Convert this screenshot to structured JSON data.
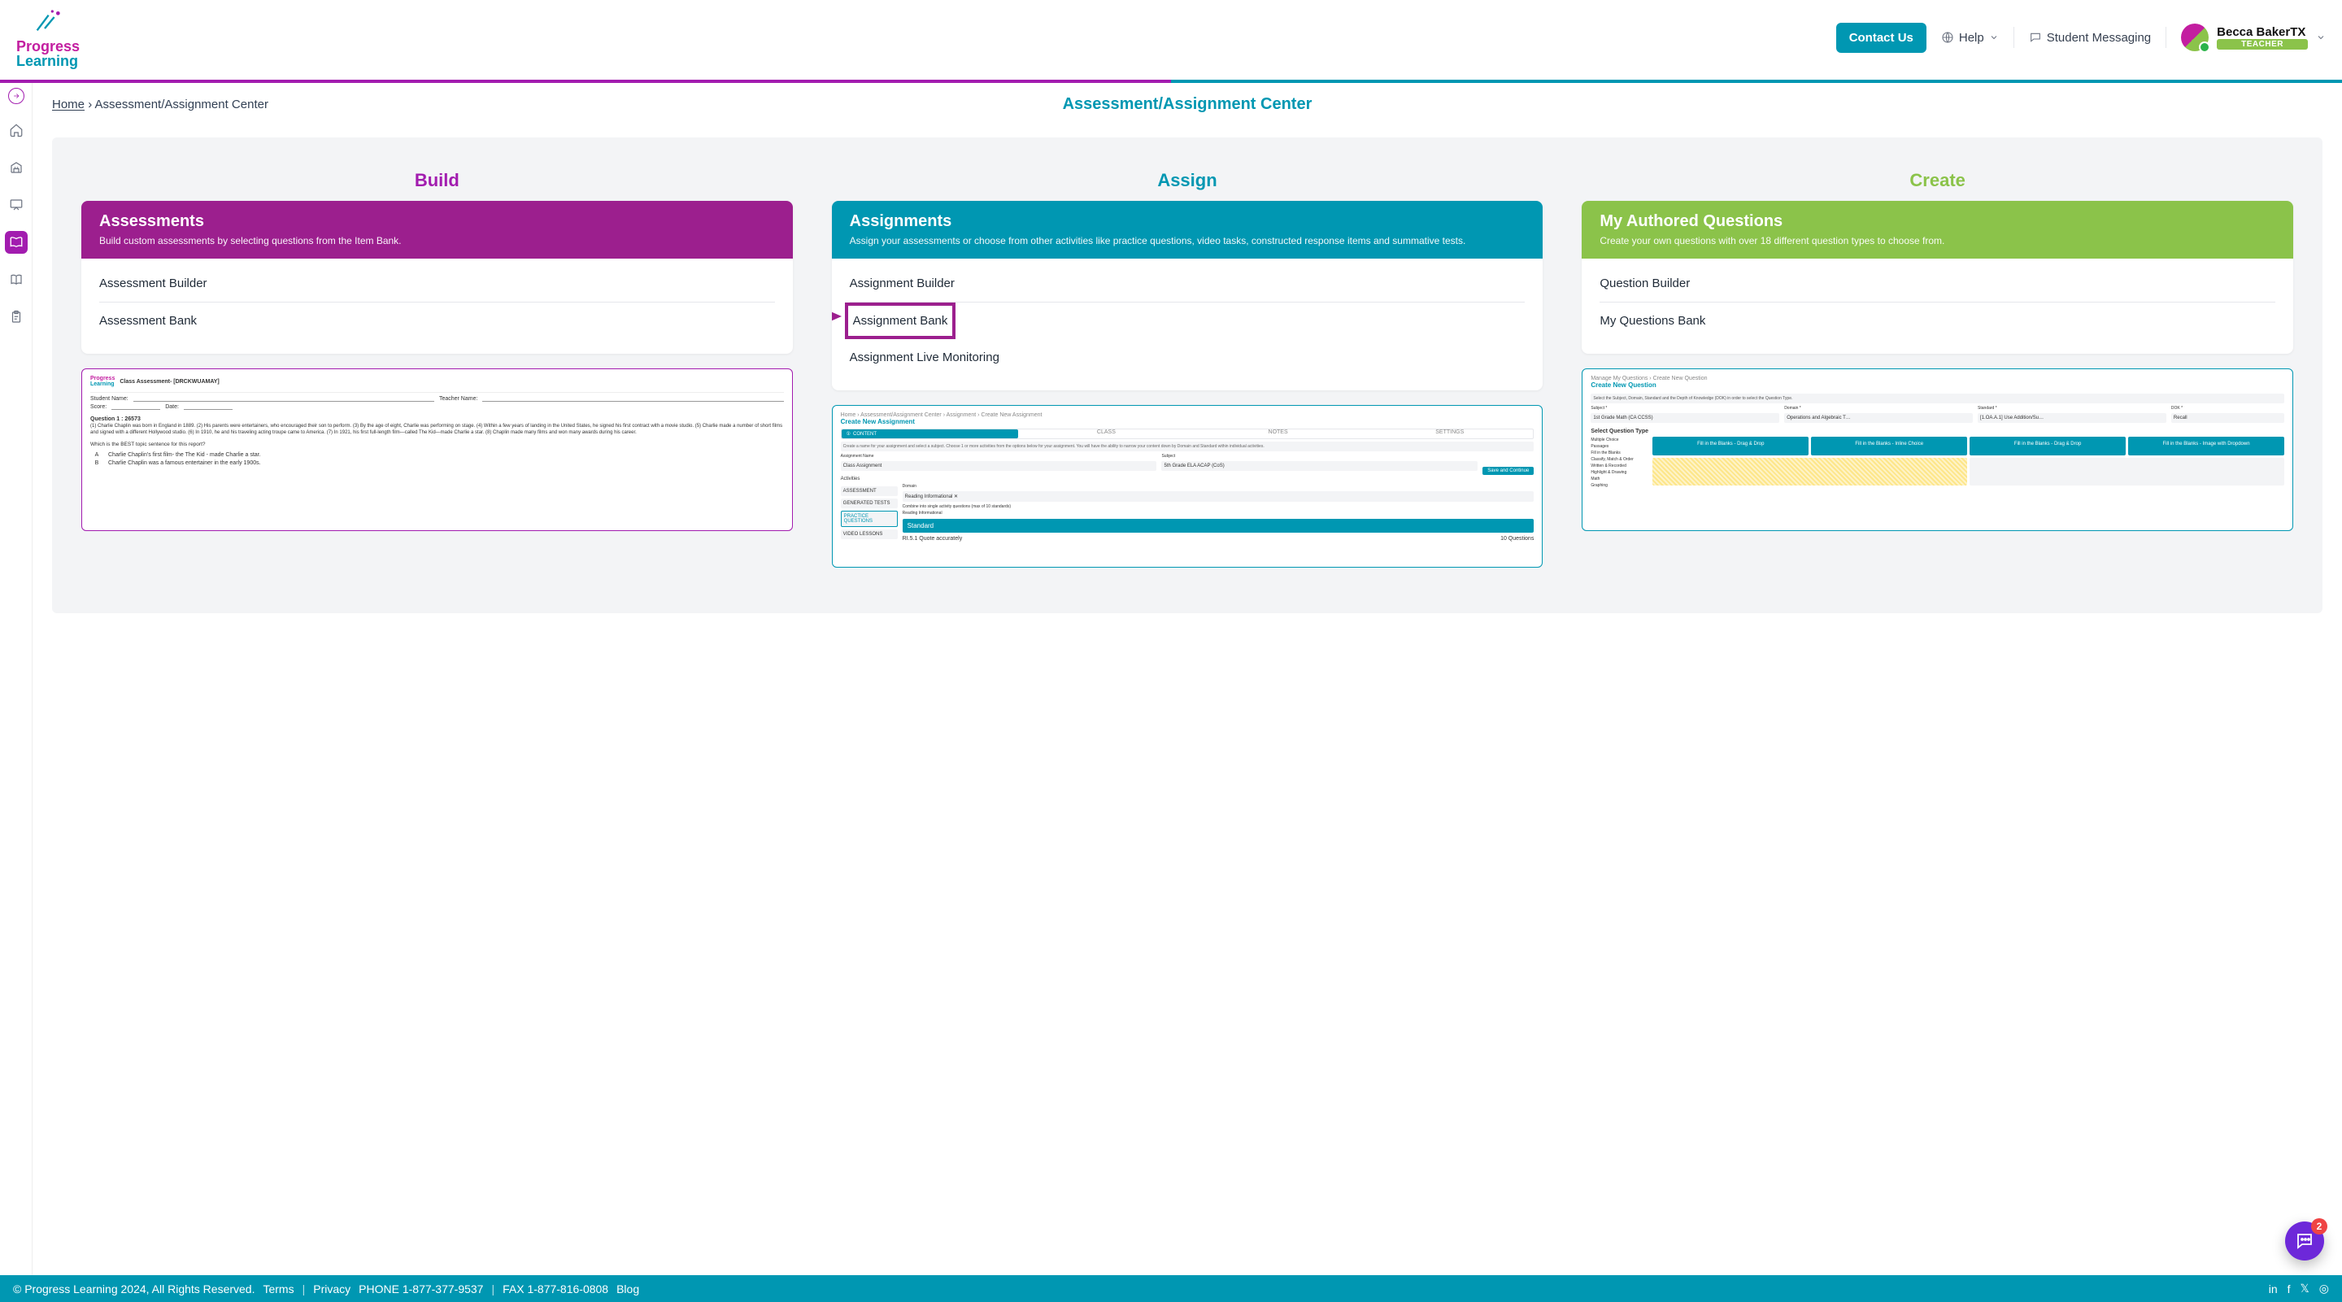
{
  "header": {
    "brand_top": "Progress",
    "brand_bottom": "Learning",
    "contact_us": "Contact Us",
    "help": "Help",
    "student_messaging": "Student Messaging",
    "user_name": "Becca BakerTX",
    "user_role": "TEACHER"
  },
  "breadcrumb": {
    "home": "Home",
    "current": "Assessment/Assignment Center"
  },
  "page_title": "Assessment/Assignment Center",
  "columns": {
    "build": {
      "heading": "Build",
      "card_title": "Assessments",
      "card_sub": "Build custom assessments by selecting questions from the Item Bank.",
      "links": [
        "Assessment Builder",
        "Assessment Bank"
      ]
    },
    "assign": {
      "heading": "Assign",
      "card_title": "Assignments",
      "card_sub": "Assign your assessments or choose from other activities like practice questions, video tasks, constructed response items and summative tests.",
      "links": [
        "Assignment Builder",
        "Assignment Bank",
        "Assignment Live Monitoring"
      ]
    },
    "create": {
      "heading": "Create",
      "card_title": "My Authored Questions",
      "card_sub": "Create your own questions with over 18 different question types to choose from.",
      "links": [
        "Question Builder",
        "My Questions Bank"
      ]
    }
  },
  "previews": {
    "build": {
      "title": "Class Assessment- [DRCKWUAMAY]",
      "student_name_label": "Student Name:",
      "teacher_name_label": "Teacher Name:",
      "score_label": "Score:",
      "date_label": "Date:",
      "q_label": "Question 1 : 26573",
      "passage": "(1) Charlie Chaplin was born in England in 1889. (2) His parents were entertainers, who encouraged their son to perform. (3) By the age of eight, Charlie was performing on stage. (4) Within a few years of landing in the United States, he signed his first contract with a movie studio. (5) Charlie made a number of short films and signed with a different Hollywood studio. (6) In 1910, he and his traveling acting troupe came to America. (7) In 1921, his first full-length film—called The Kid—made Charlie a star. (8) Chaplin made many films and won many awards during his career.",
      "prompt": "Which is the BEST topic sentence for this report?",
      "opt_a_letter": "A",
      "opt_a": "Charlie Chaplin's first film- the The Kid - made Charlie a star.",
      "opt_b_letter": "B",
      "opt_b": "Charlie Chaplin was a famous entertainer in the early 1900s."
    },
    "assign": {
      "crumb": "Home  ›  Assessment/Assignment Center  ›  Assignment  ›  Create New Assignment",
      "title": "Create New Assignment",
      "tabs": [
        "CONTENT",
        "CLASS",
        "NOTES",
        "SETTINGS"
      ],
      "hint": "Create a name for your assignment and select a subject. Choose 1 or more activities from the options below for your assignment. You will have the ability to narrow your content down by Domain and Standard within individual activities.",
      "name_label": "Assignment Name",
      "name_value": "Class Assignment",
      "subject_label": "Subject",
      "subject_value": "5th Grade ELA ACAP (CoS)",
      "save_btn": "Save and Continue",
      "activities_label": "Activities",
      "rows": [
        "ASSESSMENT",
        "GENERATED TESTS",
        "PRACTICE QUESTIONS",
        "VIDEO LESSONS"
      ],
      "domain_label": "Domain",
      "domain_value": "Reading Informational ✕",
      "combine_label": "Combine into single activity questions (max of 10 standards)",
      "standard_hdr": "Standard",
      "standard_item": "Reading Informational",
      "standard_sub": "RI.5.1 Quote accurately",
      "q_count": "10 Questions"
    },
    "create": {
      "crumb": "Manage My Questions  ›  Create New Question",
      "title": "Create New Question",
      "hint": "Select the Subject, Domain, Standard and the Depth of Knowledge (DOK) in order to select the Question Type.",
      "subject_label": "Subject *",
      "subject_value": "1st Grade Math (CA CCSS)",
      "domain_label": "Domain *",
      "domain_value": "Operations and Algebraic T…",
      "standard_label": "Standard *",
      "standard_value": "[1.OA.A.1] Use Addition/Su…",
      "dok_label": "DOK *",
      "dok_value": "Recall",
      "select_qt": "Select Question Type",
      "qt_list": [
        "Multiple Choice",
        "Passages",
        "Fill in the Blanks",
        "Classify, Match & Order",
        "Written & Recorded",
        "Highlight & Drawing",
        "Math",
        "Graphing"
      ],
      "tiles": [
        "Fill in the Blanks - Drag & Drop",
        "Fill in the Blanks - Inline Choice",
        "Fill in the Blanks - Drag & Drop",
        "Fill in the Blanks - Image with Dropdown"
      ]
    }
  },
  "footer": {
    "copyright": "© Progress Learning 2024, All Rights Reserved.",
    "terms": "Terms",
    "privacy": "Privacy",
    "phone": "PHONE 1-877-377-9537",
    "fax": "FAX 1-877-816-0808",
    "blog": "Blog"
  },
  "chat": {
    "count": "2"
  }
}
